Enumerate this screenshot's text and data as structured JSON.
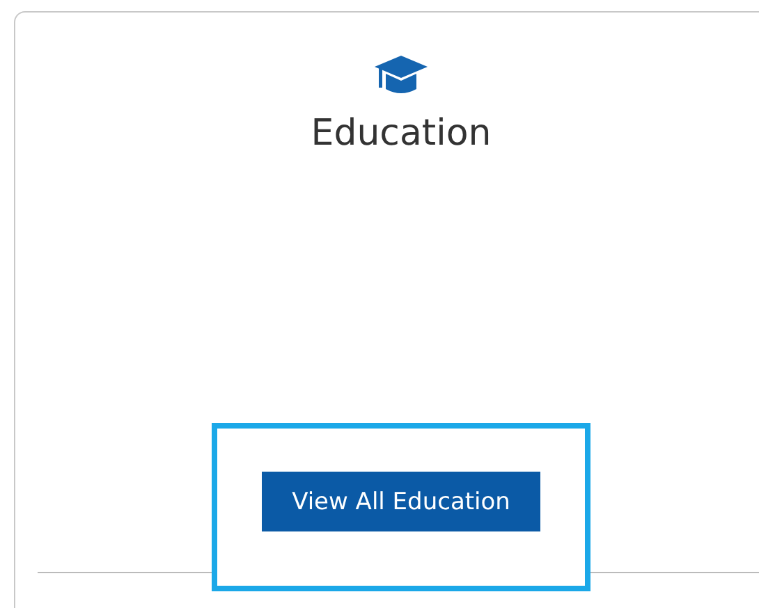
{
  "card": {
    "title": "Education",
    "button": {
      "label": "View All Education",
      "highlighted": true
    }
  }
}
